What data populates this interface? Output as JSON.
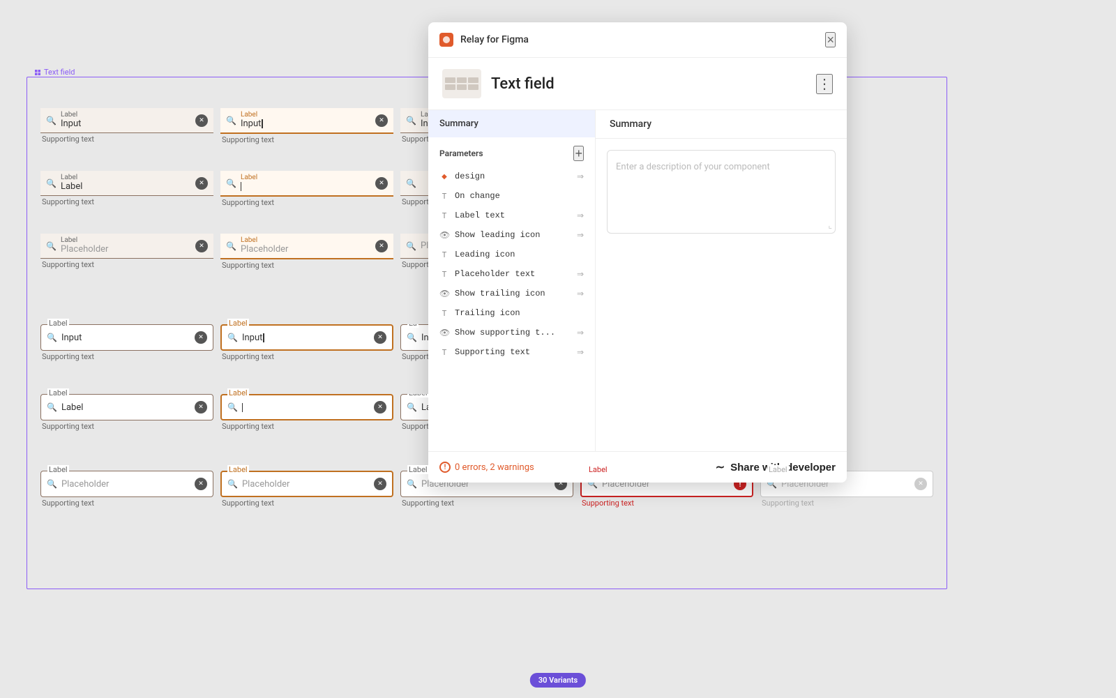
{
  "app": {
    "title": "Relay for Figma",
    "close_label": "×"
  },
  "frame_label": "Text field",
  "panel": {
    "header_title": "Relay for Figma",
    "component_name": "Text field",
    "more_icon": "⋮",
    "close_icon": "✕",
    "left_tab": "Summary",
    "parameters_label": "Parameters",
    "add_icon": "+",
    "right_title": "Summary",
    "description_placeholder": "Enter a description of your component",
    "footer": {
      "errors_text": "0 errors, 2 warnings",
      "share_label": "Share with developer"
    },
    "params": [
      {
        "type": "diamond",
        "name": "design",
        "has_arrow": true
      },
      {
        "type": "T",
        "name": "On change",
        "has_arrow": false
      },
      {
        "type": "T",
        "name": "Label text",
        "has_arrow": true
      },
      {
        "type": "eye",
        "name": "Show leading icon",
        "has_arrow": true
      },
      {
        "type": "T",
        "name": "Leading icon",
        "has_arrow": false
      },
      {
        "type": "T",
        "name": "Placeholder text",
        "has_arrow": true
      },
      {
        "type": "eye",
        "name": "Show trailing icon",
        "has_arrow": true
      },
      {
        "type": "T",
        "name": "Trailing icon",
        "has_arrow": false
      },
      {
        "type": "eye",
        "name": "Show supporting t...",
        "has_arrow": true
      },
      {
        "type": "T",
        "name": "Supporting text",
        "has_arrow": true
      }
    ]
  },
  "variants_badge": "30 Variants",
  "rows": [
    {
      "columns": [
        {
          "style": "flat",
          "label": "",
          "value": "Input",
          "show_label_above": false,
          "label_text": "Label",
          "label_color": "normal",
          "has_close": true,
          "supporting": "Supporting text"
        },
        {
          "style": "flat-orange",
          "label": "",
          "value": "Input|",
          "show_label_above": false,
          "label_text": "Label",
          "label_color": "orange",
          "has_close": true,
          "supporting": "Supporting text"
        },
        {
          "style": "flat",
          "label": "",
          "value": "Input",
          "show_label_above": false,
          "label_text": "Label",
          "label_color": "normal",
          "has_close": false,
          "supporting": "Supporting text",
          "partial": true
        }
      ]
    },
    {
      "columns": [
        {
          "style": "flat",
          "label": "",
          "value": "Label",
          "show_label_above": false,
          "label_text": "Label",
          "label_color": "normal",
          "has_close": true,
          "supporting": "Supporting text"
        },
        {
          "style": "flat-orange",
          "label": "",
          "value": "|",
          "show_label_above": false,
          "label_text": "Label",
          "label_color": "orange",
          "has_close": true,
          "supporting": "Supporting text"
        },
        {
          "style": "flat",
          "label": "",
          "value": "",
          "show_label_above": false,
          "label_text": "Label",
          "label_color": "normal",
          "has_close": false,
          "supporting": "Supporting text",
          "partial": true
        }
      ]
    },
    {
      "columns": [
        {
          "style": "flat",
          "label": "",
          "value": "Placeholder",
          "show_label_above": false,
          "label_text": "Label",
          "label_color": "normal",
          "has_close": true,
          "supporting": "Supporting text",
          "placeholder": true
        },
        {
          "style": "flat-orange",
          "label": "",
          "value": "Placeholder",
          "show_label_above": false,
          "label_text": "Label",
          "label_color": "orange",
          "has_close": true,
          "supporting": "Supporting text",
          "placeholder": true
        },
        {
          "style": "flat",
          "label": "",
          "value": "Placeholder",
          "show_label_above": false,
          "label_text": "Label",
          "label_color": "normal",
          "has_close": false,
          "supporting": "Supporting text",
          "partial": true,
          "placeholder": true
        }
      ]
    }
  ],
  "outlined_rows": [
    {
      "columns": [
        {
          "style": "outlined",
          "label": "Label",
          "label_color": "normal",
          "value": "Input",
          "has_close": true,
          "supporting": "Supporting text"
        },
        {
          "style": "outlined-orange",
          "label": "Label",
          "label_color": "orange",
          "value": "Input|",
          "has_close": true,
          "supporting": "Supporting text"
        },
        {
          "style": "outlined",
          "label": "La",
          "label_color": "normal",
          "value": "Input",
          "has_close": false,
          "supporting": "Supporting text",
          "partial": true
        }
      ]
    },
    {
      "columns": [
        {
          "style": "outlined",
          "label": "Label",
          "label_color": "normal",
          "value": "Label",
          "has_close": true,
          "supporting": "Supporting text"
        },
        {
          "style": "outlined-orange",
          "label": "Label",
          "label_color": "orange",
          "value": "|",
          "has_close": true,
          "supporting": "Supporting text"
        },
        {
          "style": "outlined",
          "label": "Label",
          "label_color": "normal",
          "value": "Label",
          "has_close": false,
          "supporting": "Supporting text",
          "partial": true
        }
      ]
    },
    {
      "columns": [
        {
          "style": "outlined",
          "label": "Label",
          "label_color": "normal",
          "value": "Placeholder",
          "has_close": true,
          "supporting": "Supporting text",
          "placeholder": true
        },
        {
          "style": "outlined-orange",
          "label": "Label",
          "label_color": "orange",
          "value": "Placeholder",
          "has_close": true,
          "supporting": "Supporting text",
          "placeholder": true
        },
        {
          "style": "outlined",
          "label": "Label",
          "label_color": "normal",
          "value": "Placeholder",
          "has_close": true,
          "supporting": "Supporting text",
          "placeholder": true
        },
        {
          "style": "outlined-red",
          "label": "Label",
          "label_color": "red",
          "value": "Placeholder",
          "has_close": false,
          "has_error": true,
          "supporting": "Supporting text",
          "supporting_color": "red",
          "placeholder": true
        },
        {
          "style": "outlined-light",
          "label": "Label",
          "label_color": "normal",
          "value": "Placeholder",
          "has_close": true,
          "supporting": "Supporting text",
          "placeholder": true,
          "light": true
        }
      ]
    }
  ]
}
